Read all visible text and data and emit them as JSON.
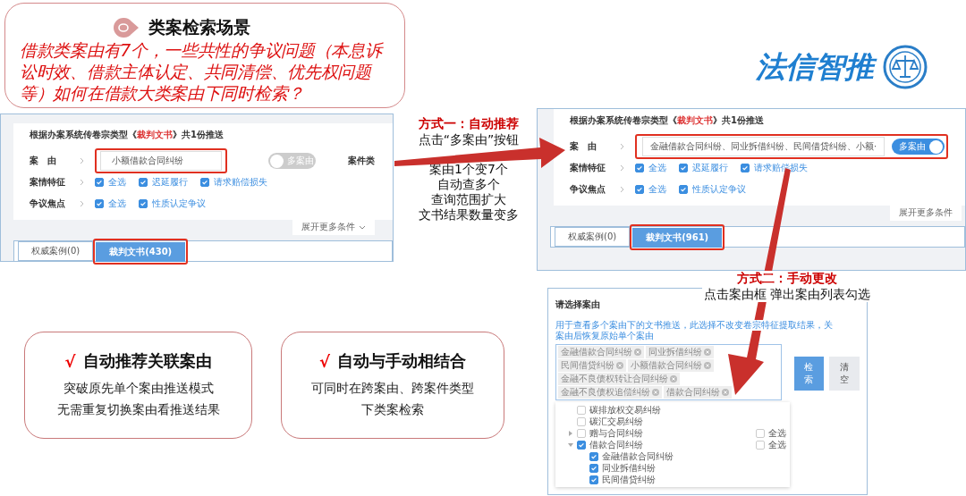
{
  "header": {
    "title": "类案检索场景",
    "question": "借款类案由有7个，一些共性的争议问题（本息诉讼时效、借款主体认定、共同清偿、优先权问题等）如何在借款大类案由下同时检索？"
  },
  "logo": {
    "text": "法信智推"
  },
  "panels": [
    {
      "notice": [
        {
          "kind": "plain",
          "text": "根据办案系统传卷宗类型《"
        },
        {
          "kind": "highlight",
          "text": "裁判文书"
        },
        {
          "kind": "plain",
          "text": "》共1份推送"
        }
      ],
      "cause_label": "案　由",
      "cause_value": "小额借款合同纠纷",
      "toggle": {
        "label": "多案由",
        "on": false
      },
      "case_type_label": "案件类",
      "features": {
        "label": "案情特征",
        "options": [
          {
            "label": "全选",
            "checked": true
          },
          {
            "label": "迟延履行",
            "checked": true
          },
          {
            "label": "请求赔偿损失",
            "checked": true
          }
        ]
      },
      "focus": {
        "label": "争议焦点",
        "options": [
          {
            "label": "全选",
            "checked": true
          },
          {
            "label": "性质认定争议",
            "checked": true
          }
        ]
      },
      "expand": {
        "label": "展开更多条件",
        "caret": true
      },
      "tabs": [
        {
          "label": "权威案例(0)",
          "selected": false
        },
        {
          "label": "裁判文书(430)",
          "selected": true
        }
      ]
    },
    {
      "notice": [
        {
          "kind": "plain",
          "text": "根据办案系统传卷宗类型《"
        },
        {
          "kind": "highlight",
          "text": "裁判文书"
        },
        {
          "kind": "plain",
          "text": "》共1份推送"
        }
      ],
      "cause_label": "案　由",
      "cause_value": "金融借款合同纠纷、同业拆借纠纷、民间借贷纠纷、小额·",
      "toggle": {
        "label": "多案由",
        "on": true
      },
      "features": {
        "label": "案情特征",
        "options": [
          {
            "label": "全选",
            "checked": true
          },
          {
            "label": "迟延履行",
            "checked": true
          },
          {
            "label": "请求赔偿损失",
            "checked": true
          }
        ]
      },
      "focus": {
        "label": "争议焦点",
        "options": [
          {
            "label": "全选",
            "checked": true
          },
          {
            "label": "性质认定争议",
            "checked": true
          }
        ]
      },
      "expand": {
        "label": "展开更多条件",
        "caret": false
      },
      "tabs": [
        {
          "label": "权威案例(0)",
          "selected": false
        },
        {
          "label": "裁判文书(961)",
          "selected": true
        }
      ]
    }
  ],
  "method_one": {
    "title": "方式一：自动推荐",
    "text": "点击“多案由”按钮",
    "notes": [
      "案由1个变7个",
      "自动查多个",
      "查询范围扩大",
      "文书结果数量变多"
    ]
  },
  "method_two": {
    "title": "方式二：手动更改",
    "text": "点击案由框 弹出案由列表勾选"
  },
  "dialog": {
    "title": "请选择案由",
    "hint": [
      "用于查看多个案由下的文书推送，此选择不改变卷宗特征提取结果，关",
      "案由后恢复原始单个案由"
    ],
    "tags": [
      "金融借款合同纠纷",
      "同业拆借纠纷",
      "民间借贷纠纷",
      "小额借款合同纠纷",
      "金融不良债权转让合同纠纷",
      "金融不良债权追偿纠纷",
      "借款合同纠纷"
    ],
    "buttons": [
      {
        "kind": "primary",
        "label": "检索"
      },
      {
        "kind": "plain",
        "label": "清空"
      }
    ],
    "tree": [
      {
        "label": "碳排放权交易纠纷",
        "checked": false
      },
      {
        "label": "碳汇交易纠纷",
        "checked": false
      },
      {
        "label": "赠与合同纠纷",
        "checked": false,
        "expanded": false,
        "select_all": {
          "label": "全选",
          "checked": false
        }
      },
      {
        "label": "借款合同纠纷",
        "checked": true,
        "expanded": true,
        "select_all": {
          "label": "全选",
          "checked": false
        },
        "children": [
          {
            "label": "金融借款合同纠纷",
            "checked": true
          },
          {
            "label": "同业拆借纠纷",
            "checked": true
          },
          {
            "label": "民间借贷纠纷",
            "checked": true
          }
        ]
      }
    ]
  },
  "cards": [
    {
      "mark": "√",
      "title": "自动推荐关联案由",
      "lines": [
        "突破原先单个案由推送模式",
        "无需重复切换案由看推送结果"
      ]
    },
    {
      "mark": "√",
      "title": "自动与手动相结合",
      "lines": [
        "可同时在跨案由、跨案件类型",
        "下类案检索"
      ]
    }
  ]
}
